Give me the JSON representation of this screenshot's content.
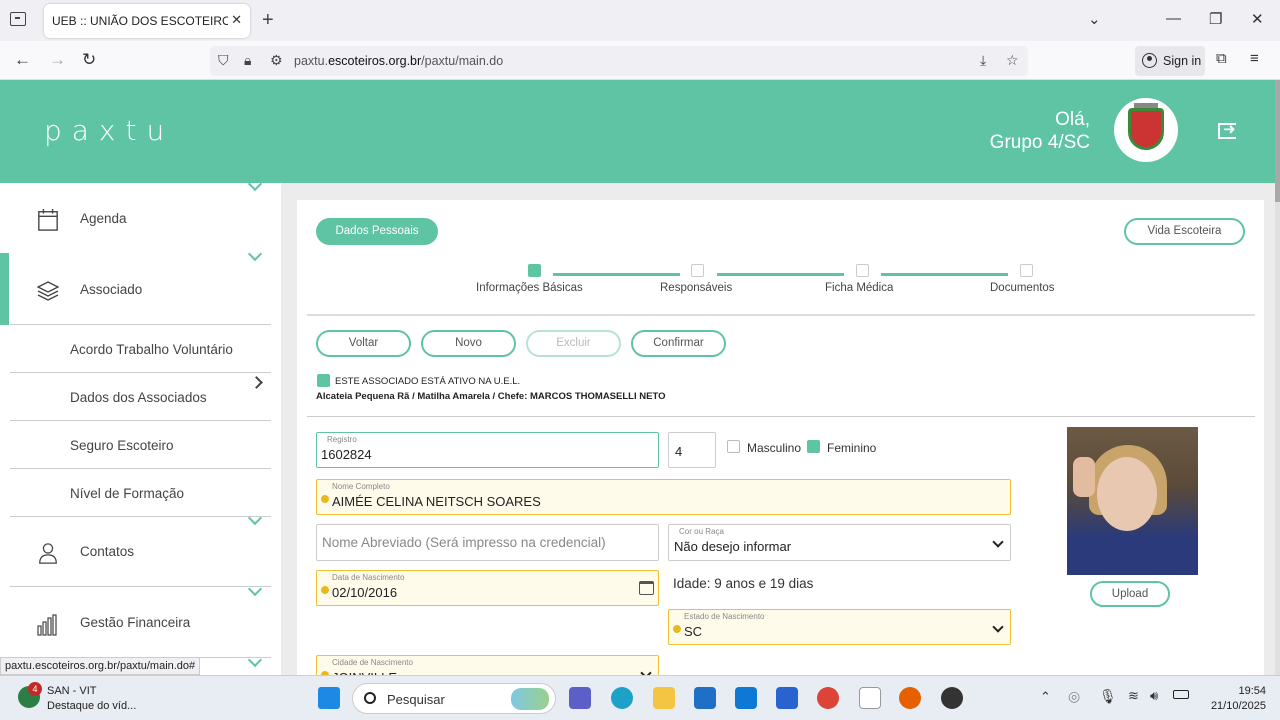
{
  "browser": {
    "tab_title": "UEB :: UNIÃO DOS ESCOTEIROS DO",
    "url_prefix": "paxtu.",
    "url_domain": "escoteiros.org.br",
    "url_path": "/paxtu/main.do",
    "sign_in": "Sign in",
    "status_url": "paxtu.escoteiros.org.br/paxtu/main.do#"
  },
  "header": {
    "logo": "paxtu",
    "greeting_line1": "Olá,",
    "greeting_line2": "Grupo 4/SC"
  },
  "sidebar": {
    "agenda": "Agenda",
    "associado": "Associado",
    "sub_items": [
      "Acordo Trabalho Voluntário",
      "Dados dos Associados",
      "Seguro Escoteiro",
      "Nível de Formação"
    ],
    "contatos": "Contatos",
    "gestao": "Gestão Financeira"
  },
  "main": {
    "dados_pessoais": "Dados Pessoais",
    "vida_escoteira": "Vida Escoteira",
    "steps": [
      "Informações Básicas",
      "Responsáveis",
      "Ficha Médica",
      "Documentos"
    ],
    "buttons": {
      "voltar": "Voltar",
      "novo": "Novo",
      "excluir": "Excluir",
      "confirmar": "Confirmar"
    },
    "status_line1": "ESTE ASSOCIADO ESTÁ ATIVO NA U.E.L.",
    "status_line2": "Alcateia Pequena Rã / Matilha Amarela / Chefe: MARCOS THOMASELLI NETO",
    "form": {
      "registro_label": "Registro",
      "registro_value": "1602824",
      "digito_value": "4",
      "masculino": "Masculino",
      "feminino": "Feminino",
      "nome_label": "Nome Completo",
      "nome_value": "AIMÉE CELINA NEITSCH SOARES",
      "abreviado_placeholder": "Nome Abreviado (Será impresso na credencial)",
      "raca_label": "Cor ou Raça",
      "raca_value": "Não desejo informar",
      "nascimento_label": "Data de Nascimento",
      "nascimento_value": "02/10/2016",
      "idade": "Idade: 9 anos e 19 dias",
      "estado_label": "Estado de Nascimento",
      "estado_value": "SC",
      "cidade_label": "Cidade de Nascimento",
      "cidade_value": "JOINVILLE",
      "upload": "Upload"
    }
  },
  "taskbar": {
    "news_title": "SAN - VIT",
    "news_sub": "Destaque do víd...",
    "news_badge": "4",
    "search": "Pesquisar",
    "time": "19:54",
    "date": "21/10/2025"
  },
  "colors": {
    "accent": "#5ec4a4",
    "warn": "#f0c030"
  }
}
